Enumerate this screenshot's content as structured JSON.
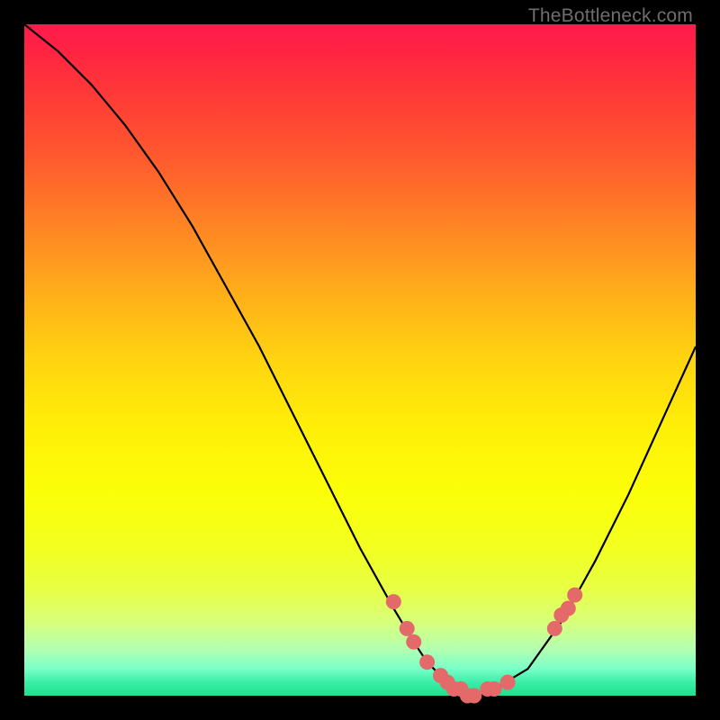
{
  "watermark": "TheBottleneck.com",
  "colors": {
    "bg": "#000000",
    "curve": "#000000",
    "dots": "#e46a6a"
  },
  "chart_data": {
    "type": "line",
    "title": "",
    "xlabel": "",
    "ylabel": "",
    "xlim": [
      0,
      100
    ],
    "ylim": [
      0,
      100
    ],
    "series": [
      {
        "name": "bottleneck-curve",
        "x": [
          0,
          5,
          10,
          15,
          20,
          25,
          30,
          35,
          40,
          45,
          50,
          55,
          58,
          60,
          62,
          64,
          66,
          68,
          70,
          75,
          80,
          85,
          90,
          95,
          100
        ],
        "y": [
          100,
          96,
          91,
          85,
          78,
          70,
          61,
          52,
          42,
          32,
          22,
          13,
          8,
          5,
          3,
          1,
          0,
          0,
          1,
          4,
          11,
          20,
          30,
          41,
          52
        ]
      }
    ],
    "highlight_points": {
      "name": "zone-dots",
      "x": [
        55,
        57,
        58,
        60,
        62,
        63,
        64,
        65,
        66,
        67,
        69,
        70,
        72,
        79,
        80,
        81,
        82
      ],
      "y": [
        14,
        10,
        8,
        5,
        3,
        2,
        1,
        1,
        0,
        0,
        1,
        1,
        2,
        10,
        12,
        13,
        15
      ]
    }
  }
}
